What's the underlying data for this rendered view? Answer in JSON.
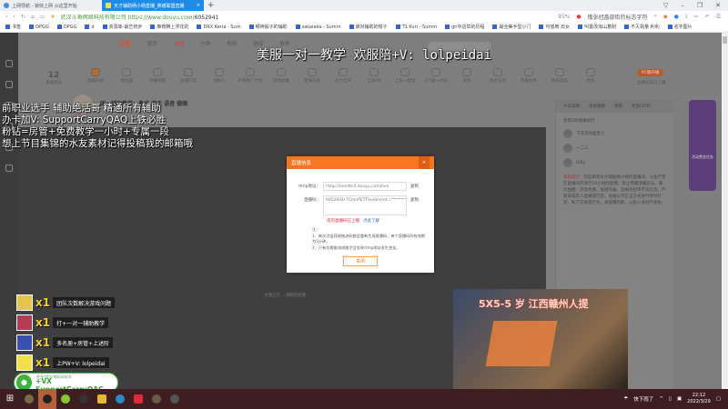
{
  "browser": {
    "tabs": [
      {
        "label": "上网导航 - 锁快上网 从这里开始",
        "active": false
      },
      {
        "label": "天才辅助杨小杨直播_英雄联盟直播",
        "active": true
      }
    ],
    "new_tab": "+",
    "window_controls": [
      "▽",
      "–",
      "❐",
      "✕"
    ],
    "site_name": "武汉斗鱼网络科技有限公司",
    "url_prefix": "https://www.douyu.com/",
    "url_path": "6052941",
    "zoom": "95%",
    "search_text": "俄张冠盖部街的标志字符",
    "bookmarks": [
      "书签",
      "OPGG",
      "OPGG",
      "d",
      "资源库-最艺统步",
      "推荐腾上浮花的",
      "DRX Keria - Sum",
      "哪神骰子的辅助",
      "sakalaka - Summ",
      "谁对辅助的帽子",
      "T1 Kuri - Summ",
      "gn中这举的历程",
      "最全美手型小门",
      "可惑牌 日女",
      "叫置改淘山着耐",
      "不灭捐量 利利",
      "名字图片"
    ]
  },
  "site": {
    "logo": "斗鱼",
    "nav": [
      "首页",
      "直播",
      "分类",
      "视频",
      "游戏",
      "鱼吧"
    ],
    "points_value": "12",
    "points_label": "主播积分",
    "tools": [
      "直播开关",
      "弹出器",
      "开播提醒",
      "主播口袋",
      "福利礼",
      "手游推广计划",
      "游戏助推",
      "星海任务",
      "火力全开",
      "全民PK",
      "上车一起玩",
      "小飞船+动态",
      "发现",
      "鱼丸任务",
      "客服助手",
      "发布动态",
      "更多"
    ],
    "pc_button": "PC端开播",
    "pc_sub": "主播前就已上播",
    "stream_title": "国一辅助教学：鼻线 游走 语音 做眼",
    "video_message": "主播正在… 请稍后观看",
    "right_panel": {
      "tabs": [
        "今日消费",
        "本周消费",
        "贵宾",
        "贵宾(378)"
      ],
      "list_title": "贵宾5的情绪排行",
      "viewers": [
        "下次见你面星儿",
        "一二三",
        "HiBy"
      ],
      "notice_label": "系统提示：",
      "notice": "欢迎来到天才辅助杨小杨的直播间。斗鱼严禁在直播间内进行24小时的直播，禁止传播涉嫌违法、暴力血腥、涉及色情、低俗诈骗、违规违纪等不良信息。严禁未成年人直播或打赏，主播以不正当方式进行诱导打赏、私下交易等行为，请谨慎判断，以防人身财产损失。"
    },
    "promo": "活动赏金任务"
  },
  "overlay": {
    "title": "美服一对一教学 欢服陪+V: lolpeidai",
    "lines": [
      "前职业选手 辅助绝活哥 精通所有辅助",
      "办卡加V: SupportCarryQAQ上铁必胜",
      "粉钻=房管+免费教学一小时+专属一段",
      "想上节目集锦的水友素材记得投稿我的邮箱哦"
    ]
  },
  "dialog": {
    "title": "直播信息",
    "close_x": "×",
    "rtmp_label": "rtmp地址：",
    "rtmp_value": "rtmp://sendtc3.douyu.com/live",
    "code_label": "直播码：",
    "code_value": "6052941r7ChmPETTtxxSecret=**********",
    "copy": "复制",
    "warning": "您的直播码已上播",
    "learn_more": "点此了解",
    "notes_title": "注：",
    "notes": [
      "1、每次点击获取推流码都会重新生成直播码，每个直播码的有效期为5分钟。",
      "2、只有切换推流线路才会导致rtmp地址发生变化。"
    ],
    "close_button": "关闭"
  },
  "gifts": [
    {
      "count": "x1",
      "text": "团队次数解决游戏问题"
    },
    {
      "count": "x1",
      "text": "打+一对一辅助教学"
    },
    {
      "count": "x1",
      "text": "多名册+房管+上述阶"
    },
    {
      "count": "x1",
      "text": "上PW+V: lolpeidai"
    }
  ],
  "wechat": {
    "small": "更多/商务/辅助请联系",
    "text": "+VX SupportCarryQAC"
  },
  "webcam": {
    "caption": "5X5-5 岁 江西赣州人提"
  },
  "taskbar": {
    "weather": "快下雨了",
    "time": "22:12",
    "date": "2022/3/29",
    "start": "⊞"
  }
}
